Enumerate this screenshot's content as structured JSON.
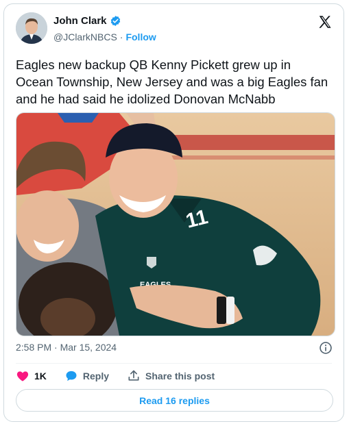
{
  "author": {
    "name": "John Clark",
    "handle": "@JClarkNBCS",
    "separator": "·",
    "follow_label": "Follow"
  },
  "tweet": {
    "text": "Eagles new backup QB Kenny Pickett grew up in Ocean Township, New Jersey and was a big Eagles fan and he had said he idolized Donovan McNabb"
  },
  "photo": {
    "jersey_number": "11",
    "jersey_wordmark": "EAGLES"
  },
  "meta": {
    "timestamp": "2:58 PM · Mar 15, 2024"
  },
  "actions": {
    "like_count": "1K",
    "reply_label": "Reply",
    "share_label": "Share this post"
  },
  "replies_button": "Read 16 replies",
  "colors": {
    "accent": "#1d9bf0",
    "like": "#f91880",
    "text": "#0f1419",
    "muted": "#536471"
  }
}
